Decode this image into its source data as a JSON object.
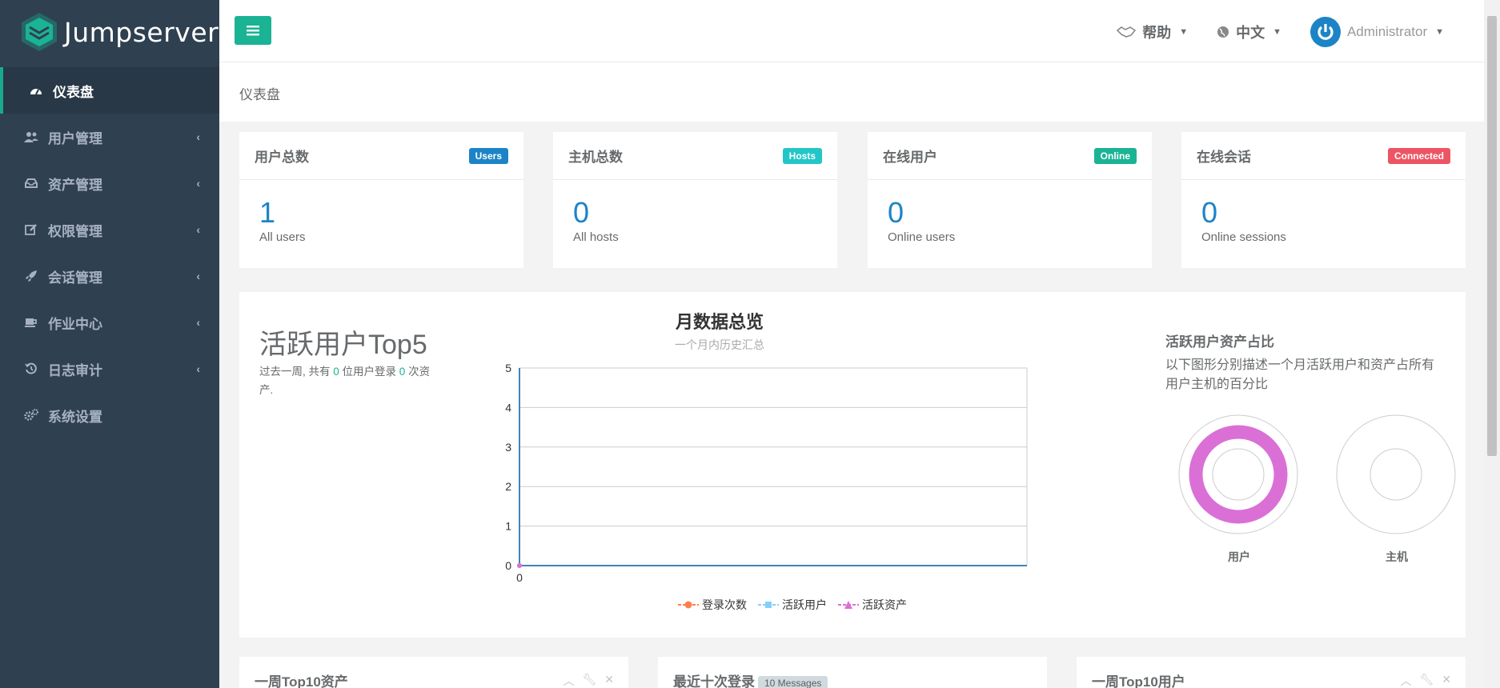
{
  "app": {
    "name": "Jumpserver"
  },
  "sidebar": {
    "items": [
      {
        "label": "仪表盘",
        "icon": "dashboard-icon",
        "active": true
      },
      {
        "label": "用户管理",
        "icon": "users-icon"
      },
      {
        "label": "资产管理",
        "icon": "inbox-icon"
      },
      {
        "label": "权限管理",
        "icon": "edit-icon"
      },
      {
        "label": "会话管理",
        "icon": "rocket-icon"
      },
      {
        "label": "作业中心",
        "icon": "coffee-icon"
      },
      {
        "label": "日志审计",
        "icon": "history-icon"
      },
      {
        "label": "系统设置",
        "icon": "gears-icon"
      }
    ],
    "chevron": "‹"
  },
  "topbar": {
    "help": "帮助",
    "language": "中文",
    "user": "Administrator"
  },
  "breadcrumb": "仪表盘",
  "stats": [
    {
      "title": "用户总数",
      "badge": "Users",
      "badge_color": "#1c84c6",
      "value": "1",
      "sub": "All users"
    },
    {
      "title": "主机总数",
      "badge": "Hosts",
      "badge_color": "#23c6c8",
      "value": "0",
      "sub": "All hosts"
    },
    {
      "title": "在线用户",
      "badge": "Online",
      "badge_color": "#1ab394",
      "value": "0",
      "sub": "Online users"
    },
    {
      "title": "在线会话",
      "badge": "Connected",
      "badge_color": "#ed5565",
      "value": "0",
      "sub": "Online sessions"
    }
  ],
  "top5": {
    "title": "活跃用户Top5",
    "desc_prefix": "过去一周, 共有 ",
    "users_count": "0",
    "desc_middle": " 位用户登录 ",
    "assets_count": "0",
    "desc_suffix": " 次资产."
  },
  "chart_data": {
    "type": "line",
    "title": "月数据总览",
    "subtitle": "一个月内历史汇总",
    "x": [
      "0"
    ],
    "ylim": [
      0,
      5
    ],
    "yticks": [
      "0",
      "1",
      "2",
      "3",
      "4",
      "5"
    ],
    "grid": true,
    "legend_position": "bottom",
    "series": [
      {
        "name": "登录次数",
        "values": [
          0
        ],
        "color": "#ff7f50"
      },
      {
        "name": "活跃用户",
        "values": [
          0
        ],
        "color": "#87cefa"
      },
      {
        "name": "活跃资产",
        "values": [
          0
        ],
        "color": "#da70d6"
      }
    ]
  },
  "ratio": {
    "title": "活跃用户资产占比",
    "desc": "以下图形分别描述一个月活跃用户和资产占所有用户主机的百分比",
    "user_label": "用户",
    "host_label": "主机",
    "user_color": "#da70d6"
  },
  "bottom": {
    "assets_title": "一周Top10资产",
    "logins_title": "最近十次登录",
    "logins_badge": "10 Messages",
    "users_title": "一周Top10用户"
  }
}
